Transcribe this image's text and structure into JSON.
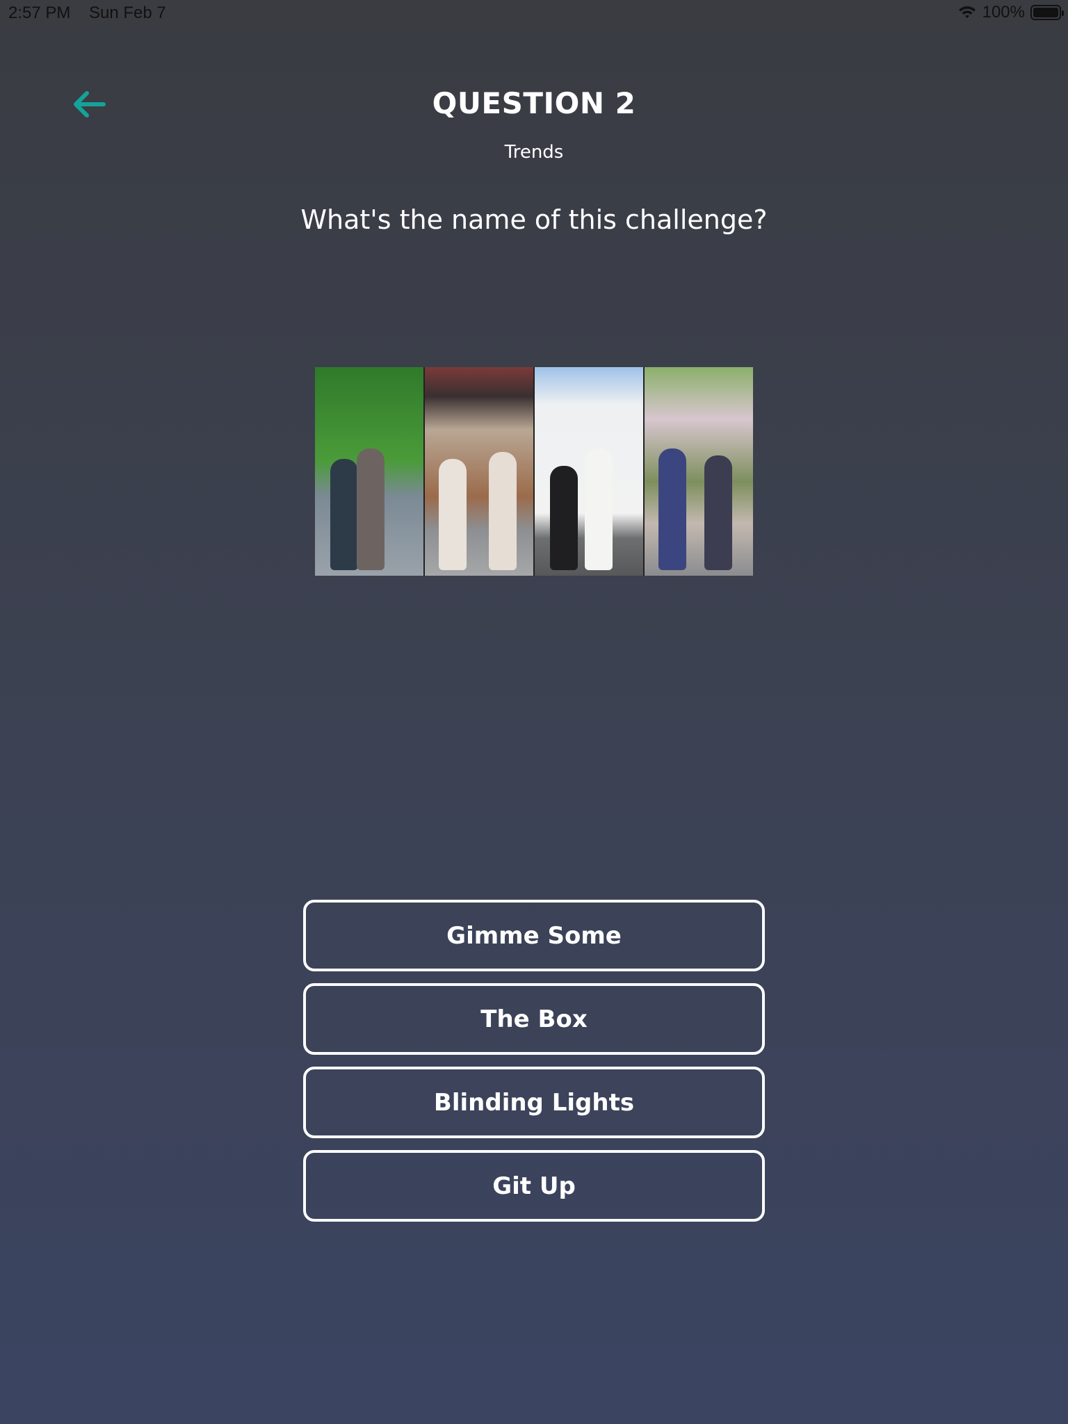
{
  "status_bar": {
    "time": "2:57 PM",
    "date": "Sun Feb 7",
    "battery": "100%"
  },
  "header": {
    "title": "QUESTION 2",
    "category": "Trends"
  },
  "question": "What's the name of this challenge?",
  "answers": [
    "Gimme Some",
    "The Box",
    "Blinding Lights",
    "Git Up"
  ],
  "colors": {
    "accent": "#14a39a",
    "button_border": "#ffffff",
    "background_top": "#3a3c42",
    "background_bottom": "#3b4461"
  },
  "icons": {
    "back": "arrow-left-icon",
    "wifi": "wifi-icon",
    "battery": "battery-icon"
  }
}
